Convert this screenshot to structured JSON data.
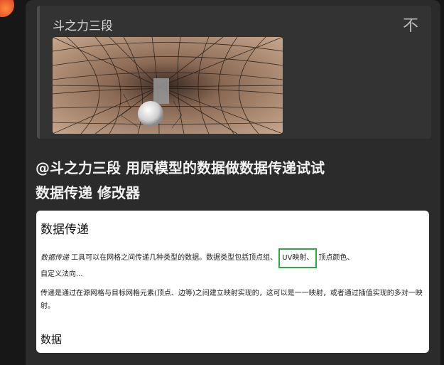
{
  "quote": {
    "author": "斗之力三段",
    "collapse_icon": "不",
    "image_alt": "wireframe-mesh-with-sphere"
  },
  "post": {
    "line1": "@斗之力三段 用原模型的数据做数据传递试试",
    "line2": "数据传递 修改器"
  },
  "doc": {
    "title": "数据传递",
    "p1_em": "数据传递",
    "p1_a": " 工具可以在网格之间传递几种类型的数据。数据类型包括顶点组、",
    "p1_uv": "UV映射、",
    "p1_b": "顶点颜色、",
    "p1_c": "自定义法向...",
    "p2": "传递是通过在源网格与目标网格元素(顶点、边等)之间建立映射实现的，这可以是一一映射，或者通过插值实现的多对一映射。",
    "subheading": "数据"
  },
  "colors": {
    "highlight": "#2eaa3f",
    "background": "#171717",
    "card": "#2b2b2b"
  }
}
